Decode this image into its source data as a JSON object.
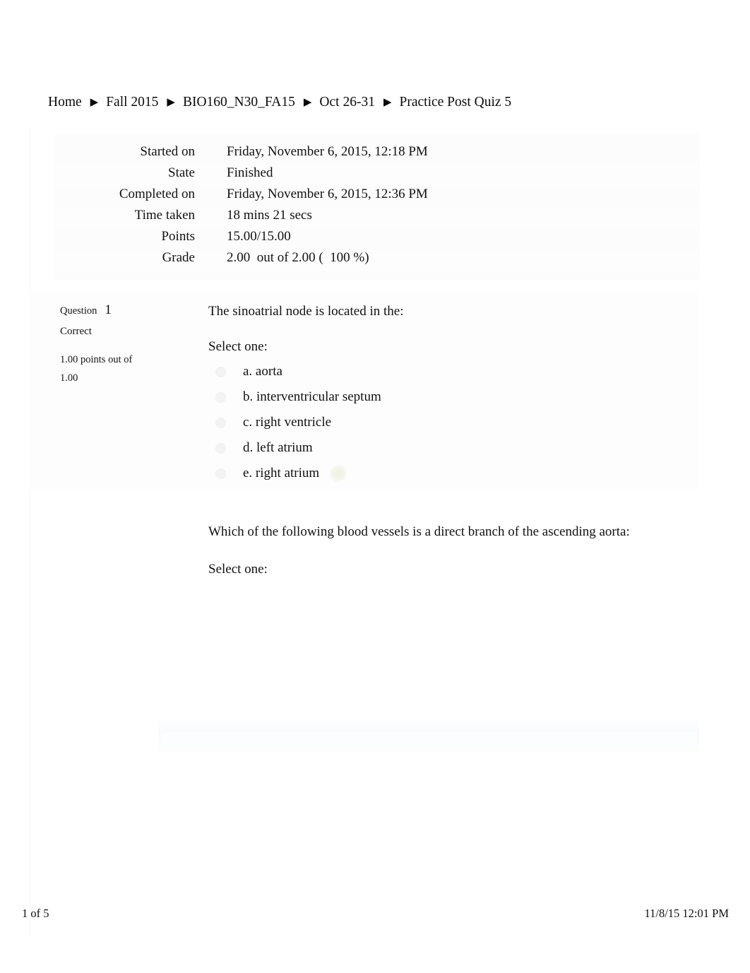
{
  "breadcrumb": {
    "separator_icon": "triangle-right-icon",
    "items": [
      {
        "label": "Home"
      },
      {
        "label": "Fall 2015"
      },
      {
        "label": "BIO160_N30_FA15"
      },
      {
        "label": "Oct 26-31"
      },
      {
        "label": "Practice Post Quiz 5"
      }
    ]
  },
  "summary": {
    "rows": [
      {
        "label": "Started on",
        "value": "Friday, November 6, 2015, 12:18 PM"
      },
      {
        "label": "State",
        "value": "Finished"
      },
      {
        "label": "Completed on",
        "value": "Friday, November 6, 2015, 12:36 PM"
      },
      {
        "label": "Time taken",
        "value": "18 mins 21 secs"
      },
      {
        "label": "Points",
        "value": "15.00/15.00"
      },
      {
        "label": "Grade",
        "value": "2.00  out of 2.00 (  100 %)"
      }
    ]
  },
  "question1": {
    "question_word": "Question",
    "number": "1",
    "state": "Correct",
    "points": "1.00 points out of 1.00",
    "text": "The sinoatrial node is located in the:",
    "select_one": "Select one:",
    "correct_marker_icon": "correct-check-icon",
    "options": [
      {
        "label": "a. aorta",
        "correct": false
      },
      {
        "label": "b. interventricular septum",
        "correct": false
      },
      {
        "label": "c. right ventricle",
        "correct": false
      },
      {
        "label": "d. left atrium",
        "correct": false
      },
      {
        "label": "e. right atrium",
        "correct": true
      }
    ]
  },
  "question2": {
    "text": "Which of the following blood vessels is a direct branch of the ascending aorta:",
    "select_one": "Select one:"
  },
  "footer": {
    "page": "1 of 5",
    "printed": "11/8/15 12:01 PM"
  },
  "colors": {
    "text": "#111111",
    "panel": "#fcfcfc",
    "correct_highlight": "#eef0e0"
  }
}
